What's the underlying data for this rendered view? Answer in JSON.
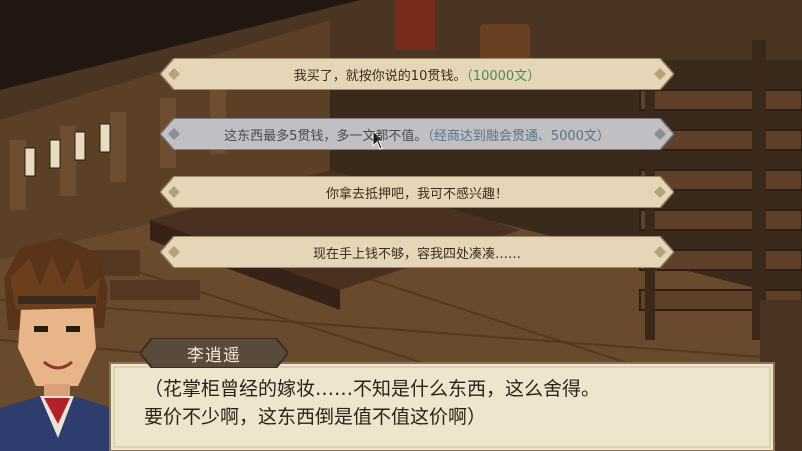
{
  "choices": [
    {
      "text": "我买了，就按你说的10贯钱。",
      "note": "（10000文）",
      "enabled": true
    },
    {
      "text": "这东西最多5贯钱，多一文都不值。",
      "note": "（经商达到融会贯通、5000文）",
      "enabled": false
    },
    {
      "text": "你拿去抵押吧，我可不感兴趣！",
      "note": "",
      "enabled": true
    },
    {
      "text": "现在手上钱不够，容我四处凑凑……",
      "note": "",
      "enabled": true
    }
  ],
  "dialog": {
    "speaker": "李逍遥",
    "line1": "（花掌柜曾经的嫁妆……不知是什么东西，这么舍得。",
    "line2": "要价不少啊，这东西倒是值不值这价啊）"
  },
  "colors": {
    "plate": "#e4d6b6",
    "plate_disabled": "#bfbfc4",
    "note_green": "#4c8a5a",
    "dialog_bg": "#efe5cf",
    "speaker_bg": "#5a4a3c"
  },
  "icons": {
    "choice_ornament": "diamond-ornament-icon",
    "cursor": "arrow-cursor-icon",
    "portrait": "character-portrait"
  }
}
